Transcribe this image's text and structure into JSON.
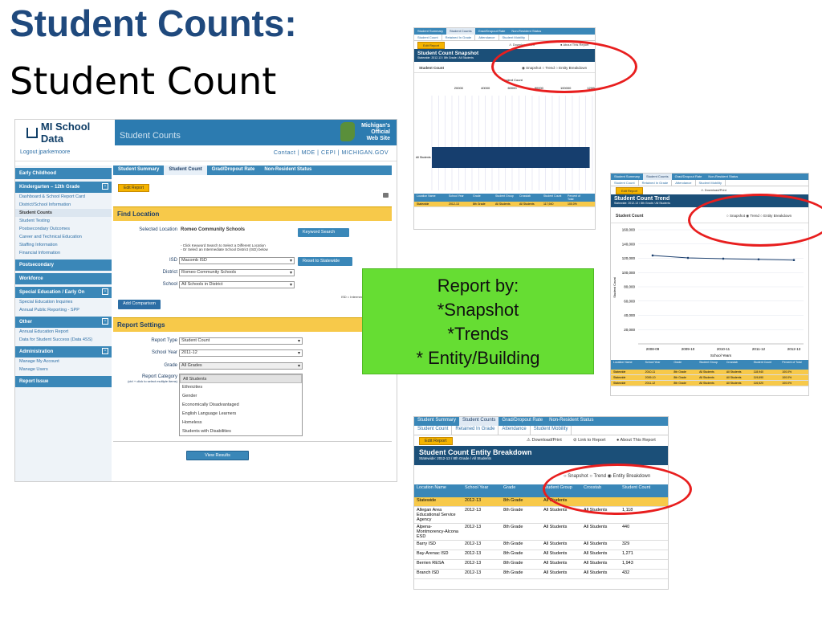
{
  "slide": {
    "title_bold": "Student Counts:",
    "title_sub": "Student Count",
    "callout_lines": [
      "Report by:",
      "*Snapshot",
      "*Trends",
      "* Entity/Building"
    ]
  },
  "main": {
    "logo": "MI School Data",
    "header_title": "Student Counts",
    "michigan_official": [
      "Michigan's",
      "Official",
      "Web Site"
    ],
    "logout": "Logout jparkemoore",
    "top_links": "Contact  |  MDE  |  CEPI  |  MICHIGAN.GOV",
    "sidebar": [
      {
        "type": "hdr",
        "label": "Early Childhood"
      },
      {
        "type": "hdr",
        "label": "Kindergarten – 12th Grade",
        "toggle": "-"
      },
      {
        "type": "it",
        "label": "Dashboard & School Report Card"
      },
      {
        "type": "it",
        "label": "District/School Information"
      },
      {
        "type": "sel",
        "label": "Student Counts"
      },
      {
        "type": "it",
        "label": "Student Testing"
      },
      {
        "type": "it",
        "label": "Postsecondary Outcomes"
      },
      {
        "type": "it",
        "label": "Career and Technical Education"
      },
      {
        "type": "it",
        "label": "Staffing Information"
      },
      {
        "type": "it",
        "label": "Financial Information"
      },
      {
        "type": "hdr",
        "label": "Postsecondary"
      },
      {
        "type": "hdr",
        "label": "Workforce"
      },
      {
        "type": "hdr",
        "label": "Special Education / Early On",
        "toggle": "-"
      },
      {
        "type": "it",
        "label": "Special Education Inquiries"
      },
      {
        "type": "it",
        "label": "Annual Public Reporting - SPP"
      },
      {
        "type": "hdr",
        "label": "Other",
        "toggle": "-"
      },
      {
        "type": "it",
        "label": "Annual Education Report"
      },
      {
        "type": "it",
        "label": "Data for Student Success (Data 4SS)"
      },
      {
        "type": "hdr",
        "label": "Administration",
        "toggle": "-"
      },
      {
        "type": "it",
        "label": "Manage My Account"
      },
      {
        "type": "it",
        "label": "Manage Users"
      },
      {
        "type": "hdr",
        "label": "Report Issue"
      }
    ],
    "tabs": [
      "Student Summary",
      "Student Count",
      "Grad/Dropout Rate",
      "Non-Resident Status"
    ],
    "edit_report": "Edit Report",
    "find_location": "Find Location",
    "selected_location_label": "Selected Location",
    "selected_location_value": "Romeo Community Schools",
    "keyword_search": "Keyword Search",
    "hint": "- Click Keyword Search to Select a Different Location\n- Or Select an Intermediate School District (ISD) below",
    "isd_label": "ISD",
    "isd_value": "Macomb ISD",
    "reset_statewide": "Reset to Statewide",
    "district_label": "District",
    "district_value": "Romeo Community Schools",
    "school_label": "School",
    "school_value": "All Schools in District",
    "isd_note": "ISD = Intermed",
    "add_comparison": "Add Comparison",
    "report_settings": "Report Settings",
    "report_type_label": "Report Type",
    "report_type_value": "Student Count",
    "school_year_label": "School Year",
    "school_year_value": "2011-12",
    "grade_label": "Grade",
    "grade_value": "All Grades",
    "report_category_label": "Report Category",
    "report_category_hint": "(ctrl + click to select multiple items)",
    "categories": [
      "All Students",
      "Ethnicities",
      "Gender",
      "Economically Disadvantaged",
      "English Language Learners",
      "Homeless",
      "Students with Disabilities"
    ],
    "view_results": "View Results"
  },
  "snapshot": {
    "tabs": [
      "Student Summary",
      "Student Counts",
      "Grad/Dropout Rate",
      "Non-Resident Status"
    ],
    "subtabs": [
      "Student Count",
      "Retained In Grade",
      "Attendance",
      "Student Mobility"
    ],
    "edit_report": "Edit Report",
    "download": "Download/Print",
    "about": "About This Report",
    "title": "Student Count Snapshot",
    "subtitle": "Statewide: 2012-13 / 8th Grade / All Students",
    "section_label": "Student Count",
    "radio": [
      "Snapshot",
      "Trend",
      "Entity Breakdown"
    ],
    "axis_title": "Student Count",
    "ticks": [
      "20000",
      "40000",
      "60000",
      "80000",
      "100000",
      "120000"
    ],
    "bar_label": "All Students",
    "columns": [
      "Location Name",
      "School Year",
      "Grade",
      "Student Group",
      "Crosstab",
      "Student Count",
      "Percent of Total"
    ],
    "row": [
      "Statewide",
      "2012-13",
      "8th Grade",
      "All Students",
      "All Students",
      "117,940",
      "100.0%"
    ]
  },
  "trend": {
    "tabs": [
      "Student Summary",
      "Student Counts",
      "Grad/Dropout Rate",
      "Non-Resident Status"
    ],
    "subtabs": [
      "Student Count",
      "Retained In Grade",
      "Attendance",
      "Student Mobility"
    ],
    "edit_report": "Edit Report",
    "download": "Download/Print",
    "title": "Student Count Trend",
    "subtitle": "Statewide: 2012-13 / 8th Grade / All Students",
    "section_label": "Student Count",
    "radio": [
      "Snapshot",
      "Trend",
      "Entity Breakdown"
    ],
    "y_label": "Student Count",
    "y_ticks": [
      "160,000",
      "140,000",
      "120,000",
      "100,000",
      "80,000",
      "60,000",
      "40,000",
      "20,000"
    ],
    "x_ticks": [
      "2008-09",
      "2009-10",
      "2010-11",
      "2011-12",
      "2012-13"
    ],
    "x_label": "School Years",
    "columns": [
      "Location Name",
      "School Year",
      "Grade",
      "Student Group",
      "Crosstab",
      "Student Count",
      "Percent of Total"
    ],
    "rows": [
      [
        "Statewide",
        "2010-11",
        "8th Grade",
        "All Students",
        "All Students",
        "118,940",
        "100.0%"
      ],
      [
        "Statewide",
        "2009-10",
        "8th Grade",
        "All Students",
        "All Students",
        "119,690",
        "100.0%"
      ],
      [
        "Statewide",
        "2011-12",
        "8th Grade",
        "All Students",
        "All Students",
        "116,520",
        "100.0%"
      ]
    ]
  },
  "entity": {
    "tabs": [
      "Student Summary",
      "Student Counts",
      "Grad/Dropout Rate",
      "Non-Resident Status"
    ],
    "subtabs": [
      "Student Count",
      "Retained In Grade",
      "Attendance",
      "Student Mobility"
    ],
    "edit_report": "Edit Report",
    "download": "Download/Print",
    "link": "Link to Report",
    "about": "About This Report",
    "title": "Student Count Entity Breakdown",
    "subtitle": "Statewide: 2012-13 / 8th Grade / All Students",
    "radio": [
      "Snapshot",
      "Trend",
      "Entity Breakdown"
    ],
    "columns": [
      "Location Name",
      "School Year",
      "Grade",
      "Student Group",
      "Crosstab",
      "Student Count"
    ],
    "rows": [
      [
        "Statewide",
        "2012-13",
        "8th Grade",
        "All Students",
        "",
        ""
      ],
      [
        "Allegan Area Educational Service Agency",
        "2012-13",
        "8th Grade",
        "All Students",
        "All Students",
        "1,118"
      ],
      [
        "Alpena-Montmorency-Alcona ESD",
        "2012-13",
        "8th Grade",
        "All Students",
        "All Students",
        "440"
      ],
      [
        "Barry ISD",
        "2012-13",
        "8th Grade",
        "All Students",
        "All Students",
        "329"
      ],
      [
        "Bay-Arenac ISD",
        "2012-13",
        "8th Grade",
        "All Students",
        "All Students",
        "1,271"
      ],
      [
        "Berrien RESA",
        "2012-13",
        "8th Grade",
        "All Students",
        "All Students",
        "1,943"
      ],
      [
        "Branch ISD",
        "2012-13",
        "8th Grade",
        "All Students",
        "All Students",
        "432"
      ]
    ]
  },
  "chart_data": [
    {
      "type": "bar",
      "categories": [
        "All Students"
      ],
      "values": [
        117940
      ],
      "title": "Student Count Snapshot",
      "xlabel": "Student Count",
      "ylabel": "",
      "xlim": [
        0,
        120000
      ]
    },
    {
      "type": "line",
      "x": [
        "2008-09",
        "2009-10",
        "2010-11",
        "2011-12",
        "2012-13"
      ],
      "series": [
        {
          "values": [
            124000,
            120500,
            119500,
            118500,
            117500
          ]
        }
      ],
      "title": "Student Count Trend",
      "xlabel": "School Years",
      "ylabel": "Student Count",
      "ylim": [
        0,
        160000
      ]
    }
  ]
}
